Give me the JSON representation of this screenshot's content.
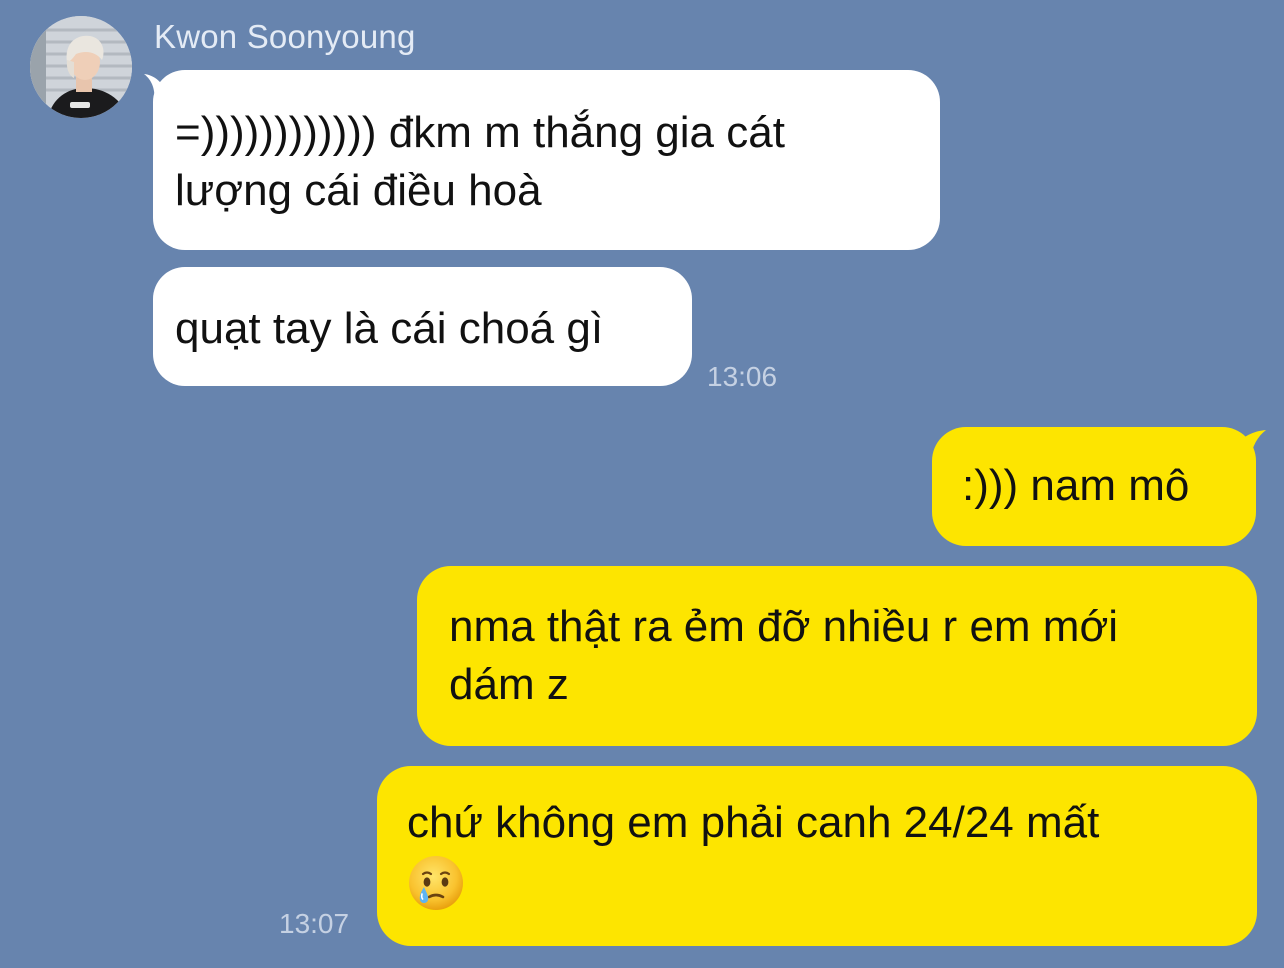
{
  "contact": {
    "name": "Kwon Soonyoung",
    "avatar_icon": "profile-photo"
  },
  "colors": {
    "background": "#6784ae",
    "incoming_bubble": "#ffffff",
    "outgoing_bubble": "#fde500",
    "timestamp": "#c5d1e3",
    "sender_name": "#e4ebf5"
  },
  "messages": [
    {
      "direction": "incoming",
      "lines": [
        "=))))))))))))  đkm m thắng gia cát",
        "lượng cái điều hoà"
      ]
    },
    {
      "direction": "incoming",
      "lines": [
        "quạt tay là cái choá gì"
      ],
      "time": "13:06"
    },
    {
      "direction": "outgoing",
      "lines": [
        ":))) nam mô"
      ]
    },
    {
      "direction": "outgoing",
      "lines": [
        "nma thật ra ẻm đỡ nhiều r em mới",
        "dám z"
      ]
    },
    {
      "direction": "outgoing",
      "lines": [
        "chứ không em phải canh 24/24 mất",
        ""
      ],
      "emoji": "face-holding-back-tears",
      "time": "13:07"
    }
  ]
}
